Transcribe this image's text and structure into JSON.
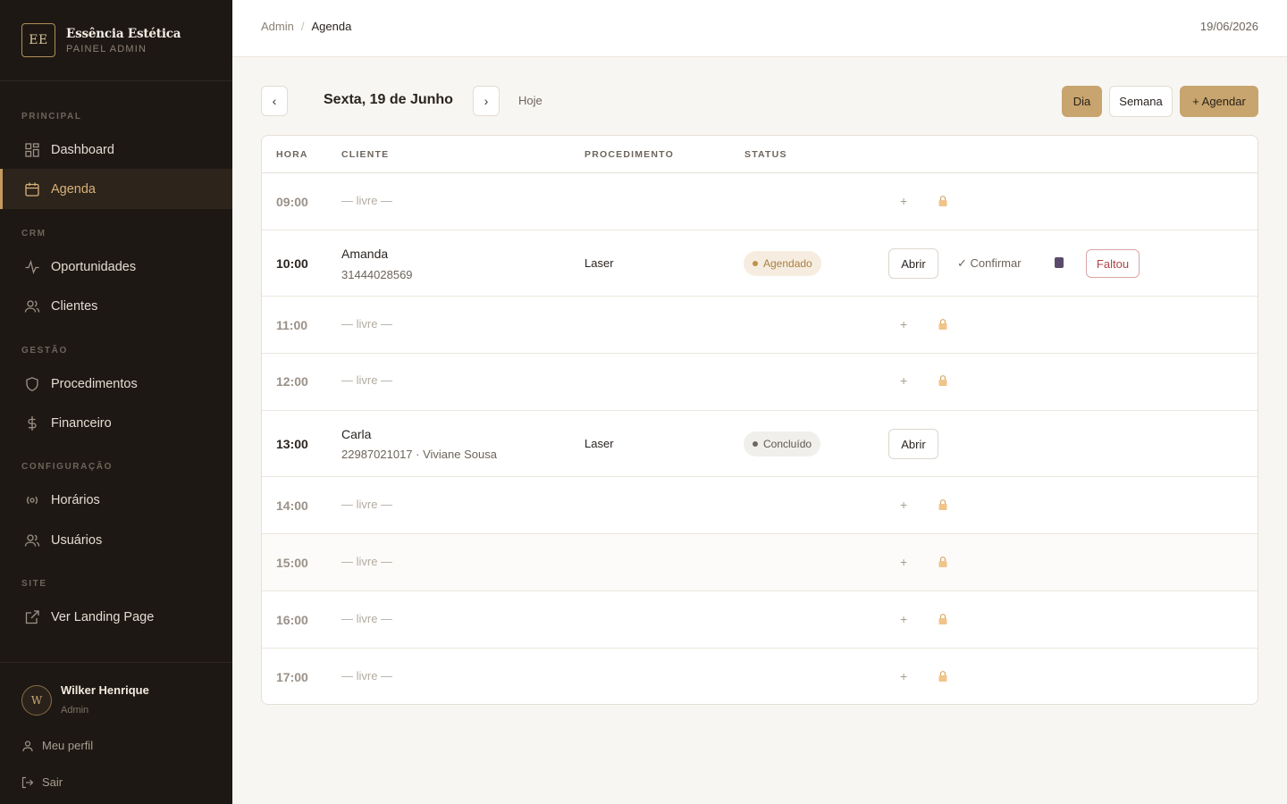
{
  "brand": {
    "logo": "EE",
    "name": "Essência Estética",
    "subtitle": "PAINEL ADMIN"
  },
  "sidebar": {
    "sections": [
      {
        "title": "PRINCIPAL"
      },
      {
        "title": "CRM"
      },
      {
        "title": "GESTÃO"
      },
      {
        "title": "CONFIGURAÇÃO"
      },
      {
        "title": "SITE"
      }
    ],
    "items": [
      {
        "label": "Dashboard",
        "icon": "grid-icon"
      },
      {
        "label": "Agenda",
        "icon": "calendar-icon",
        "active": true
      },
      {
        "label": "Oportunidades",
        "icon": "activity-icon"
      },
      {
        "label": "Clientes",
        "icon": "users-icon"
      },
      {
        "label": "Procedimentos",
        "icon": "shield-icon"
      },
      {
        "label": "Financeiro",
        "icon": "dollar-icon"
      },
      {
        "label": "Horários",
        "icon": "radio-icon"
      },
      {
        "label": "Usuários",
        "icon": "users-icon"
      },
      {
        "label": "Ver Landing Page",
        "icon": "external-link-icon"
      }
    ]
  },
  "user": {
    "initial": "W",
    "name": "Wilker Henrique",
    "role": "Admin",
    "profile_label": "Meu perfil",
    "logout_label": "Sair"
  },
  "topbar": {
    "crumb_root": "Admin",
    "crumb_sep": "/",
    "crumb_current": "Agenda",
    "date": "19/06/2026"
  },
  "toolbar": {
    "prev": "‹",
    "next": "›",
    "day_title": "Sexta, 19 de Junho",
    "today_label": "Hoje",
    "view_day": "Dia",
    "view_week": "Semana",
    "add_label": "+ Agendar"
  },
  "table": {
    "headers": {
      "time": "HORA",
      "client": "CLIENTE",
      "procedure": "PROCEDIMENTO",
      "status": "STATUS"
    },
    "free_label": "— livre —",
    "plus": "+",
    "rows": [
      {
        "time": "09:00",
        "free": true
      },
      {
        "time": "10:00",
        "free": false,
        "client": "Amanda",
        "client_sub": "31444028569",
        "procedure": "Laser",
        "status": "Agendado",
        "open_label": "Abrir",
        "confirm_label": "✓ Confirmar",
        "noshow_label": "Faltou"
      },
      {
        "time": "11:00",
        "free": true
      },
      {
        "time": "12:00",
        "free": true
      },
      {
        "time": "13:00",
        "free": false,
        "client": "Carla",
        "client_sub": "22987021017 · Viviane Sousa",
        "procedure": "Laser",
        "status": "Concluído",
        "open_label": "Abrir"
      },
      {
        "time": "14:00",
        "free": true
      },
      {
        "time": "15:00",
        "free": true
      },
      {
        "time": "16:00",
        "free": true
      },
      {
        "time": "17:00",
        "free": true
      }
    ]
  },
  "colors": {
    "sidebar_bg": "#1d1814",
    "accent": "#c8a56e",
    "danger": "#b04444"
  }
}
